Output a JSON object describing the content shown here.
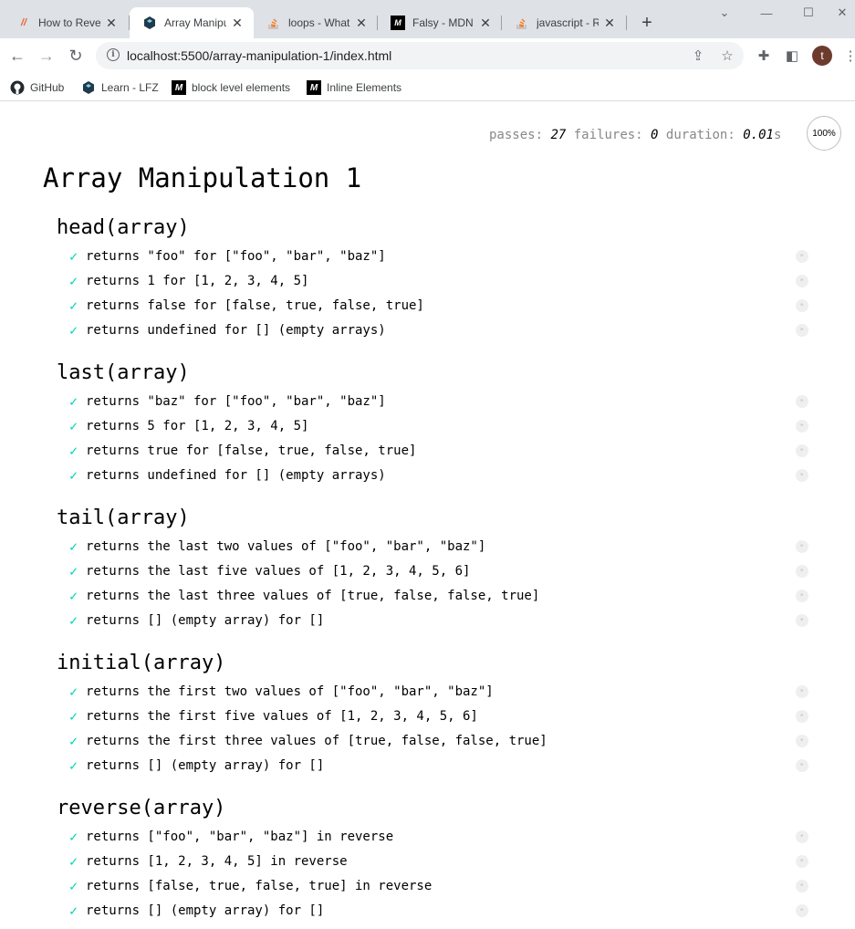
{
  "browser": {
    "tabs": [
      {
        "title": "How to Rever",
        "icon": "code-slash-icon"
      },
      {
        "title": "Array Manipu",
        "icon": "learn-fuse-icon"
      },
      {
        "title": "loops - What",
        "icon": "stackoverflow-icon"
      },
      {
        "title": "Falsy - MDN W",
        "icon": "mdn-icon"
      },
      {
        "title": "javascript - Re",
        "icon": "stackoverflow-icon"
      }
    ],
    "active_tab": 1,
    "url": "localhost:5500/array-manipulation-1/index.html",
    "avatar_letter": "t",
    "bookmarks": [
      {
        "label": "GitHub",
        "icon": "github-icon"
      },
      {
        "label": "Learn - LFZ",
        "icon": "learn-fuse-icon"
      },
      {
        "label": "block level elements",
        "icon": "mdn-icon"
      },
      {
        "label": "Inline Elements",
        "icon": "mdn-icon"
      }
    ]
  },
  "mocha": {
    "passes_label": "passes:",
    "passes": "27",
    "failures_label": "failures:",
    "failures": "0",
    "duration_label": "duration:",
    "duration": "0.01",
    "duration_unit": "s",
    "progress": "100%",
    "suite_title": "Array Manipulation 1",
    "groups": [
      {
        "title": "head(array)",
        "tests": [
          "returns \"foo\" for [\"foo\", \"bar\", \"baz\"]",
          "returns 1 for [1, 2, 3, 4, 5]",
          "returns false for [false, true, false, true]",
          "returns undefined for [] (empty arrays)"
        ]
      },
      {
        "title": "last(array)",
        "tests": [
          "returns \"baz\" for [\"foo\", \"bar\", \"baz\"]",
          "returns 5 for [1, 2, 3, 4, 5]",
          "returns true for [false, true, false, true]",
          "returns undefined for [] (empty arrays)"
        ]
      },
      {
        "title": "tail(array)",
        "tests": [
          "returns the last two values of [\"foo\", \"bar\", \"baz\"]",
          "returns the last five values of [1, 2, 3, 4, 5, 6]",
          "returns the last three values of [true, false, false, true]",
          "returns [] (empty array) for []"
        ]
      },
      {
        "title": "initial(array)",
        "tests": [
          "returns the first two values of [\"foo\", \"bar\", \"baz\"]",
          "returns the first five values of [1, 2, 3, 4, 5, 6]",
          "returns the first three values of [true, false, false, true]",
          "returns [] (empty array) for []"
        ]
      },
      {
        "title": "reverse(array)",
        "tests": [
          "returns [\"foo\", \"bar\", \"baz\"] in reverse",
          "returns [1, 2, 3, 4, 5] in reverse",
          "returns [false, true, false, true] in reverse",
          "returns [] (empty array) for []"
        ]
      }
    ],
    "colors": {
      "pass_check": "#00d6b2"
    }
  }
}
